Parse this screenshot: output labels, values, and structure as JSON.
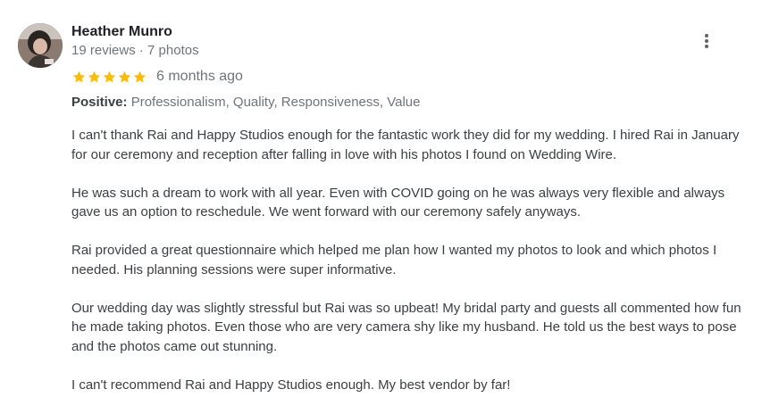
{
  "review": {
    "author_name": "Heather Munro",
    "author_meta": "19 reviews · 7 photos",
    "rating": 5,
    "rating_max": 5,
    "star_color": "#fbbc04",
    "time_ago": "6 months ago",
    "positive_label": "Positive:",
    "positive_values": " Professionalism, Quality, Responsiveness, Value",
    "paragraphs": [
      "I can't thank Rai and Happy Studios enough for the fantastic work they did for my wedding. I hired Rai in January for our ceremony and reception after falling in love with his photos I found on Wedding Wire.",
      "He was such a dream to work with all year. Even with COVID going on he was always very flexible and always gave us an option to reschedule. We went forward with our ceremony safely anyways.",
      "Rai provided a great questionnaire which helped me plan how I wanted my photos to look and which photos I needed. His planning sessions were super informative.",
      "Our wedding day was slightly stressful but Rai was so upbeat! My bridal party and guests all commented how fun he made taking photos. Even those who are very camera shy like my husband. He told us the best ways to pose and the photos came out stunning.",
      "I can't recommend Rai and Happy Studios enough. My best vendor by far!"
    ],
    "more_options_icon": "more-vert-icon"
  }
}
